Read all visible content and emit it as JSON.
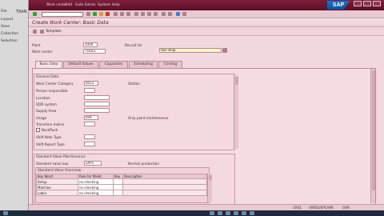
{
  "background_window": {
    "lines": [
      "File",
      "Layout",
      "Save",
      "Collection",
      "Selection"
    ],
    "tran_label": "TRAN"
  },
  "menubar": {
    "items": [
      "Work center",
      "Edit",
      "Goto",
      "Extras",
      "System",
      "Help"
    ],
    "logo": "SAP"
  },
  "title": "Create Work Center: Basic Data",
  "toolbar": {
    "template_label": "Template"
  },
  "header": {
    "plant_label": "Plant",
    "plant_value": "1000",
    "work_center_label": "Work center",
    "work_center_value": "TOOLS",
    "desc_label": "Recruit for",
    "desc_value": "tool shop"
  },
  "tabs": [
    "Basic Data",
    "Default Values",
    "Capacities",
    "Scheduling",
    "Costing"
  ],
  "general_data": {
    "title": "General Data",
    "fields": [
      {
        "label": "Work Center Category",
        "value": "0013",
        "text": "Station"
      },
      {
        "label": "Person responsible",
        "value": "",
        "text": ""
      },
      {
        "label": "Location",
        "value": "",
        "text": ""
      },
      {
        "label": "QDR system",
        "value": "",
        "text": ""
      },
      {
        "label": "Supply Area",
        "value": "",
        "text": ""
      },
      {
        "label": "Usage",
        "value": "009",
        "text": "Only plant maintenance"
      },
      {
        "label": "Transition matrix",
        "value": "",
        "text": ""
      }
    ],
    "backflush_label": "Backflush",
    "shift_note_label": "Shift Note Type",
    "shift_report_label": "Shift Report Type"
  },
  "standard_values": {
    "title": "Standard Value Maintenance",
    "key_label": "Standard value key",
    "key_value": "SAP1",
    "key_text": "Normal production",
    "overview_title": "Standard Value Overview",
    "columns": [
      "Key Word",
      "Rule for Maint.",
      "Key",
      "Description"
    ],
    "rows": [
      {
        "key_word": "Setup",
        "rule": "no checking",
        "key": "",
        "description": ""
      },
      {
        "key_word": "Machine",
        "rule": "no checking",
        "key": "",
        "description": ""
      },
      {
        "key_word": "Labor",
        "rule": "no checking",
        "key": "",
        "description": ""
      }
    ]
  },
  "status": {
    "system": "CR01",
    "server": "VIRIDUSPCAP6",
    "mode": "OVR"
  }
}
